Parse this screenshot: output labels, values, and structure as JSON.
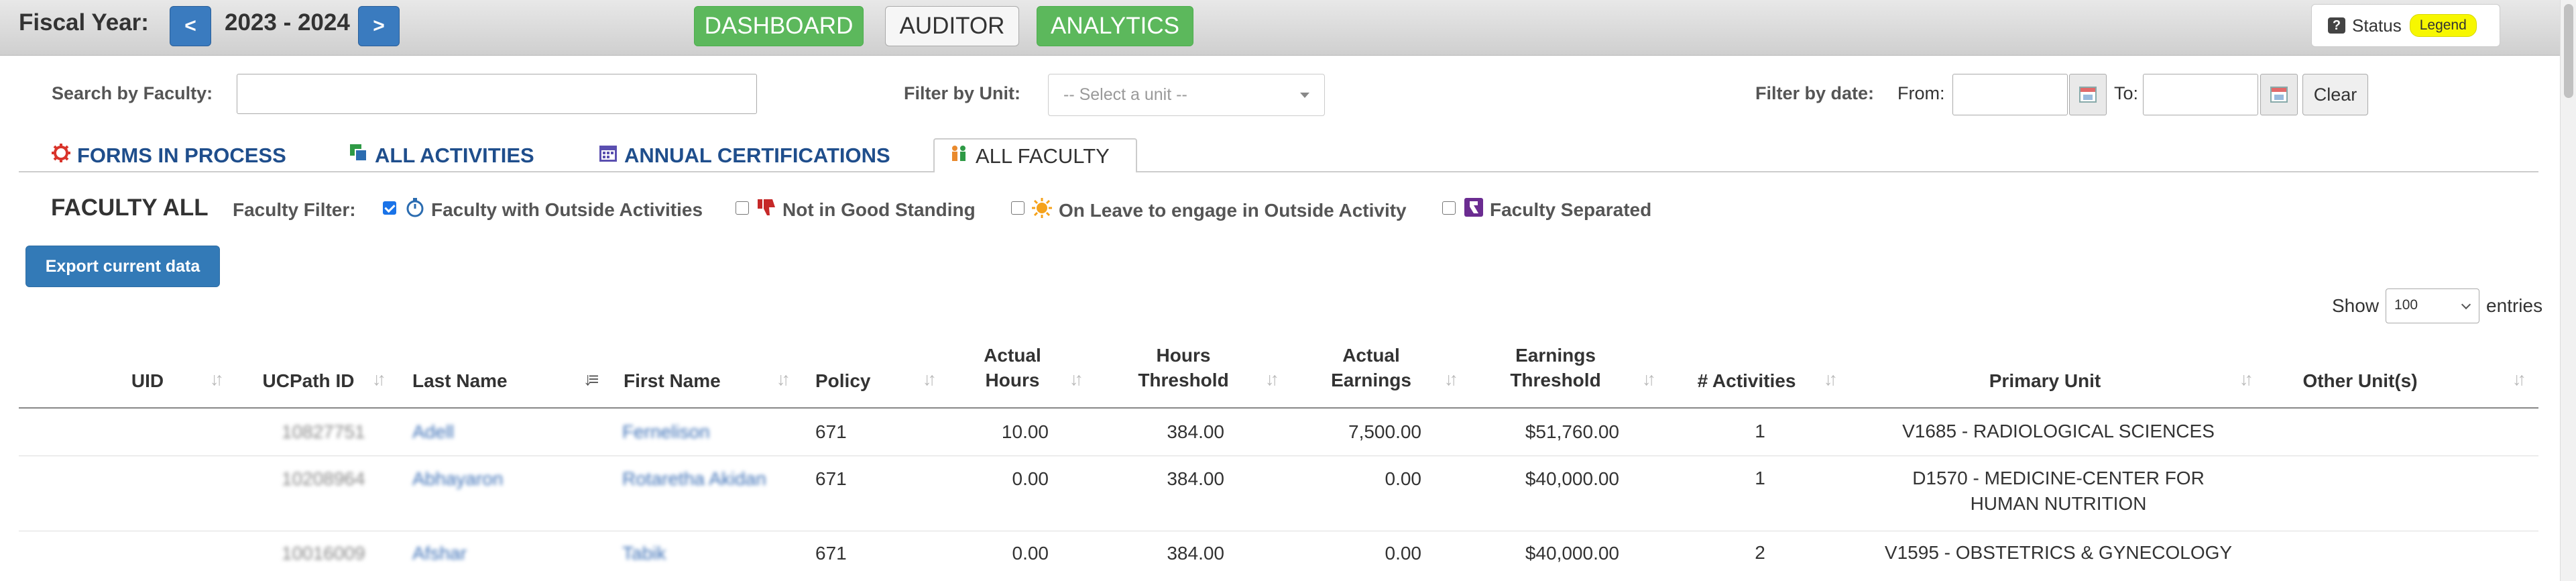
{
  "topbar": {
    "fiscal_label": "Fiscal Year:",
    "prev_label": "<",
    "year_value": "2023 - 2024",
    "next_label": ">",
    "nav": [
      "DASHBOARD",
      "AUDITOR",
      "ANALYTICS"
    ],
    "status_label": "Status",
    "legend_label": "Legend"
  },
  "filters": {
    "search_label": "Search by Faculty:",
    "search_value": "",
    "unit_label": "Filter by Unit:",
    "unit_placeholder": "-- Select a unit --",
    "date_label": "Filter by date:",
    "from_label": "From:",
    "to_label": "To:",
    "clear_label": "Clear"
  },
  "tabs": {
    "items": [
      "FORMS IN PROCESS",
      "ALL ACTIVITIES",
      "ANNUAL CERTIFICATIONS",
      "ALL FACULTY"
    ],
    "active": "ALL FACULTY"
  },
  "faculty": {
    "title": "FACULTY ALL",
    "filter_label": "Faculty Filter:",
    "options": [
      {
        "label": "Faculty with Outside Activities",
        "checked": true
      },
      {
        "label": "Not in Good Standing",
        "checked": false
      },
      {
        "label": "On Leave to engage in Outside Activity",
        "checked": false
      },
      {
        "label": "Faculty Separated",
        "checked": false
      }
    ],
    "export_label": "Export current data"
  },
  "entries": {
    "show_label": "Show",
    "value": "100",
    "suffix": "entries"
  },
  "table": {
    "headers": {
      "uid": "UID",
      "ucpath": "UCPath ID",
      "last": "Last Name",
      "first": "First Name",
      "policy": "Policy",
      "actual_hours_1": "Actual",
      "actual_hours_2": "Hours",
      "hours_threshold_1": "Hours",
      "hours_threshold_2": "Threshold",
      "actual_earnings_1": "Actual",
      "actual_earnings_2": "Earnings",
      "earnings_threshold_1": "Earnings",
      "earnings_threshold_2": "Threshold",
      "activities": "# Activities",
      "primary_unit": "Primary Unit",
      "other_units": "Other Unit(s)"
    },
    "rows": [
      {
        "ucpath": "10827751",
        "last": "Adell",
        "first": "Fernelison",
        "policy": "671",
        "actual_hours": "10.00",
        "hours_threshold": "384.00",
        "actual_earnings": "7,500.00",
        "earnings_threshold": "$51,760.00",
        "activities": "1",
        "primary_unit": "V1685 - RADIOLOGICAL SCIENCES"
      },
      {
        "ucpath": "10208964",
        "last": "Abhayaron",
        "first": "Rotaretha Akidan",
        "policy": "671",
        "actual_hours": "0.00",
        "hours_threshold": "384.00",
        "actual_earnings": "0.00",
        "earnings_threshold": "$40,000.00",
        "activities": "1",
        "primary_unit": "D1570 - MEDICINE-CENTER FOR HUMAN NUTRITION"
      },
      {
        "ucpath": "10016009",
        "last": "Afshar",
        "first": "Tabik",
        "policy": "671",
        "actual_hours": "0.00",
        "hours_threshold": "384.00",
        "actual_earnings": "0.00",
        "earnings_threshold": "$40,000.00",
        "activities": "2",
        "primary_unit": "V1595 - OBSTETRICS & GYNECOLOGY"
      }
    ]
  },
  "colors": {
    "primary": "#337ab7",
    "success": "#5cb85c",
    "tab_text": "#1f4e8c",
    "legend": "#f7f700"
  }
}
